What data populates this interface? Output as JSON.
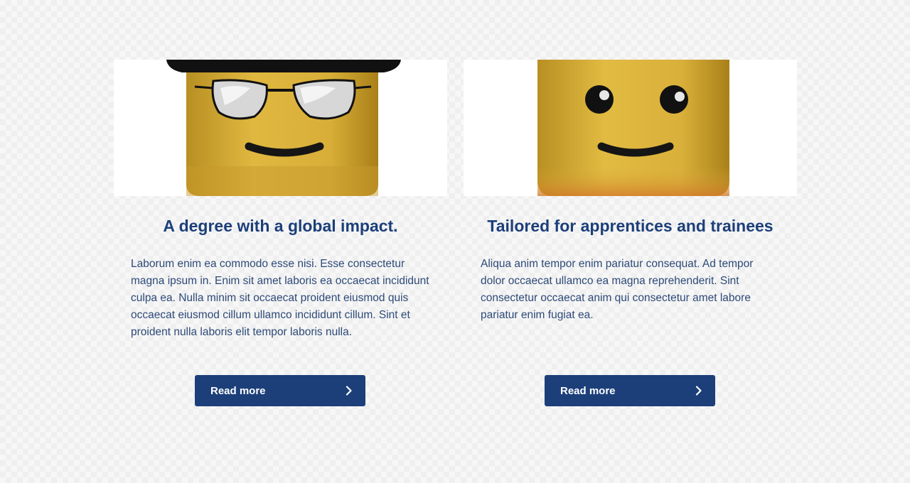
{
  "cards": [
    {
      "title": "A degree with a global impact.",
      "body": "Laborum enim ea commodo esse nisi. Esse consectetur magna ipsum in. Enim sit amet laboris ea occaecat incididunt culpa ea. Nulla minim sit occaecat proident eiusmod quis occaecat eiusmod cillum ullamco incididunt cillum. Sint et proident nulla laboris elit tempor laboris nulla.",
      "button_label": "Read more",
      "image_icon": "lego-head-sunglasses-icon"
    },
    {
      "title": "Tailored for apprentices and trainees",
      "body": "Aliqua anim tempor enim pariatur consequat. Ad tempor dolor occaecat ullamco ea magna reprehenderit. Sint consectetur occaecat anim qui consectetur amet labore pariatur enim fugiat ea.",
      "button_label": "Read more",
      "image_icon": "lego-head-smiley-icon"
    }
  ],
  "colors": {
    "brand": "#1c3f7a",
    "body_text": "#2d4a78",
    "lego_yellow": "#d9b13a"
  }
}
